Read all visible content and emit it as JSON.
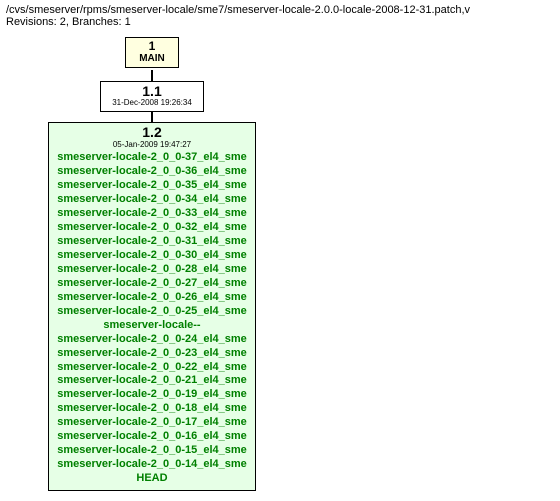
{
  "header": {
    "path": "/cvs/smeserver/rpms/smeserver-locale/sme7/smeserver-locale-2.0.0-locale-2008-12-31.patch,v",
    "revs": "Revisions: 2, Branches: 1"
  },
  "nodes": {
    "main": {
      "num": "1",
      "label": "MAIN"
    },
    "r11": {
      "num": "1.1",
      "date": "31-Dec-2008 19:26:34"
    },
    "r12": {
      "num": "1.2",
      "date": "05-Jan-2009 19:47:27",
      "tags": [
        "smeserver-locale-2_0_0-37_el4_sme",
        "smeserver-locale-2_0_0-36_el4_sme",
        "smeserver-locale-2_0_0-35_el4_sme",
        "smeserver-locale-2_0_0-34_el4_sme",
        "smeserver-locale-2_0_0-33_el4_sme",
        "smeserver-locale-2_0_0-32_el4_sme",
        "smeserver-locale-2_0_0-31_el4_sme",
        "smeserver-locale-2_0_0-30_el4_sme",
        "smeserver-locale-2_0_0-28_el4_sme",
        "smeserver-locale-2_0_0-27_el4_sme",
        "smeserver-locale-2_0_0-26_el4_sme",
        "smeserver-locale-2_0_0-25_el4_sme",
        "smeserver-locale--",
        "smeserver-locale-2_0_0-24_el4_sme",
        "smeserver-locale-2_0_0-23_el4_sme",
        "smeserver-locale-2_0_0-22_el4_sme",
        "smeserver-locale-2_0_0-21_el4_sme",
        "smeserver-locale-2_0_0-19_el4_sme",
        "smeserver-locale-2_0_0-18_el4_sme",
        "smeserver-locale-2_0_0-17_el4_sme",
        "smeserver-locale-2_0_0-16_el4_sme",
        "smeserver-locale-2_0_0-15_el4_sme",
        "smeserver-locale-2_0_0-14_el4_sme",
        "HEAD"
      ]
    }
  }
}
